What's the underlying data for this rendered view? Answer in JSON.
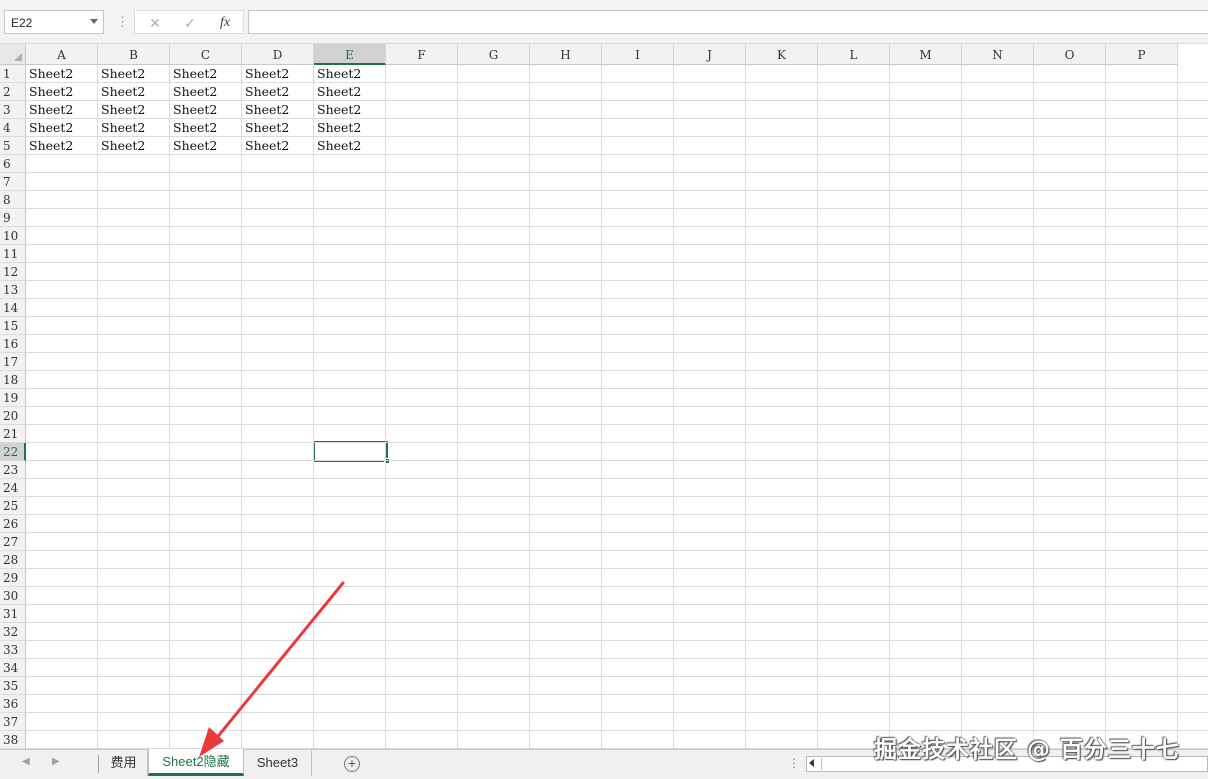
{
  "formula_bar": {
    "name_box": "E22",
    "divider": "⋮",
    "cancel_icon": "✕",
    "enter_icon": "✓",
    "fx_label": "fx",
    "formula_value": ""
  },
  "grid": {
    "columns": [
      "A",
      "B",
      "C",
      "D",
      "E",
      "F",
      "G",
      "H",
      "I",
      "J",
      "K",
      "L",
      "M",
      "N",
      "O",
      "P"
    ],
    "rows": [
      "1",
      "2",
      "3",
      "4",
      "5",
      "6",
      "7",
      "8",
      "9",
      "10",
      "11",
      "12",
      "13",
      "14",
      "15",
      "16",
      "17",
      "18",
      "19",
      "20",
      "21",
      "22",
      "23",
      "24",
      "25",
      "26",
      "27",
      "28",
      "29",
      "30",
      "31",
      "32",
      "33",
      "34",
      "35",
      "36",
      "37",
      "38"
    ],
    "active_column": "E",
    "active_row": "22",
    "cells": [
      [
        "Sheet2",
        "Sheet2",
        "Sheet2",
        "Sheet2",
        "Sheet2"
      ],
      [
        "Sheet2",
        "Sheet2",
        "Sheet2",
        "Sheet2",
        "Sheet2"
      ],
      [
        "Sheet2",
        "Sheet2",
        "Sheet2",
        "Sheet2",
        "Sheet2"
      ],
      [
        "Sheet2",
        "Sheet2",
        "Sheet2",
        "Sheet2",
        "Sheet2"
      ],
      [
        "Sheet2",
        "Sheet2",
        "Sheet2",
        "Sheet2",
        "Sheet2"
      ]
    ]
  },
  "tabs": {
    "nav_prev": "◀",
    "nav_next": "▶",
    "sheets": [
      "费用",
      "Sheet2隐藏",
      "Sheet3"
    ],
    "active_index": 1,
    "add_sheet": "+",
    "dots": "⋮"
  },
  "annotation": {
    "arrow_color": "#e83a3a",
    "watermark": "掘金技术社区 @ 百分三十七"
  }
}
